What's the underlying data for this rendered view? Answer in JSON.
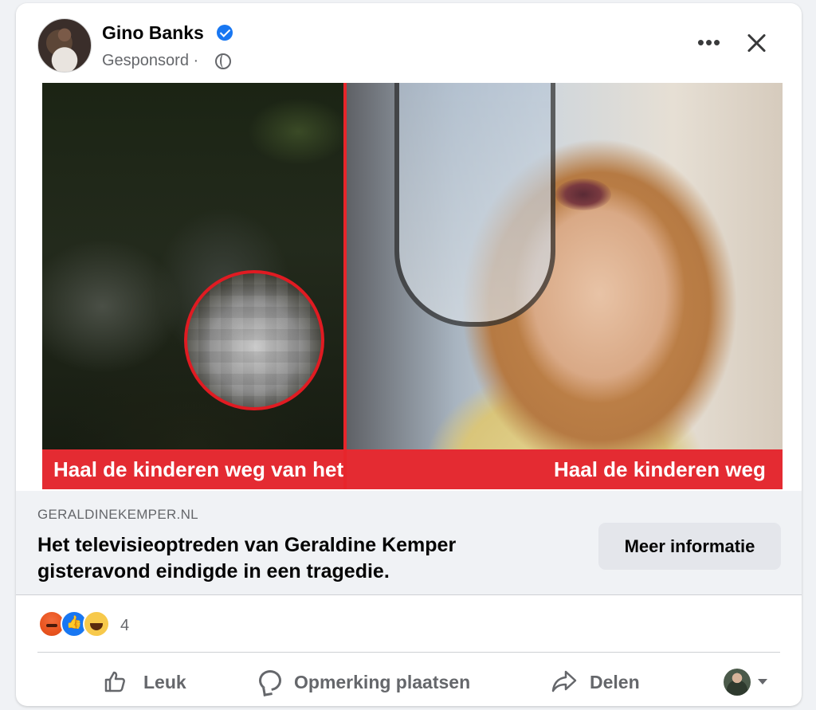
{
  "post": {
    "author": "Gino Banks",
    "sponsored_label": "Gesponsord",
    "separator": "·"
  },
  "ad": {
    "banner_left": "Haal de kinderen weg van het beeldscherm!",
    "banner_right": "Haal de kinderen weg"
  },
  "link": {
    "domain": "GERALDINEKEMPER.NL",
    "headline": "Het televisieoptreden van Geraldine Kemper gisteravond eindigde in een tragedie.",
    "cta_label": "Meer informatie"
  },
  "reactions": {
    "count": "4",
    "types": [
      "angry",
      "like",
      "haha"
    ]
  },
  "actions": {
    "like_label": "Leuk",
    "comment_label": "Opmerking plaatsen",
    "share_label": "Delen"
  },
  "colors": {
    "accent": "#1877f2",
    "banner_red": "#e42b32",
    "muted_text": "#65676b"
  }
}
